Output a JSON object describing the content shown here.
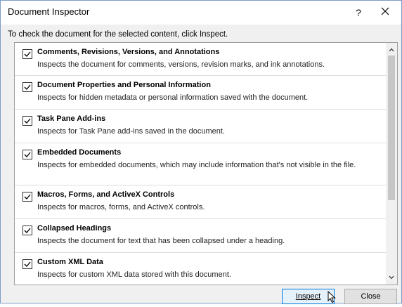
{
  "window": {
    "title": "Document Inspector",
    "help_label": "?"
  },
  "instruction": "To check the document for the selected content, click Inspect.",
  "items": [
    {
      "title": "Comments, Revisions, Versions, and Annotations",
      "description": "Inspects the document for comments, versions, revision marks, and ink annotations.",
      "checked": true
    },
    {
      "title": "Document Properties and Personal Information",
      "description": "Inspects for hidden metadata or personal information saved with the document.",
      "checked": true
    },
    {
      "title": "Task Pane Add-ins",
      "description": "Inspects for Task Pane add-ins saved in the document.",
      "checked": true
    },
    {
      "title": "Embedded Documents",
      "description": "Inspects for embedded documents, which may include information that's not visible in the file.",
      "checked": true
    },
    {
      "title": "Macros, Forms, and ActiveX Controls",
      "description": "Inspects for macros, forms, and ActiveX controls.",
      "checked": true
    },
    {
      "title": "Collapsed Headings",
      "description": "Inspects the document for text that has been collapsed under a heading.",
      "checked": true
    },
    {
      "title": "Custom XML Data",
      "description": "Inspects for custom XML data stored with this document.",
      "checked": true
    }
  ],
  "buttons": {
    "inspect_label": "Inspect",
    "close_label": "Close"
  },
  "colors": {
    "accent": "#0078d7",
    "dialog_bg": "#f0f0f0"
  }
}
